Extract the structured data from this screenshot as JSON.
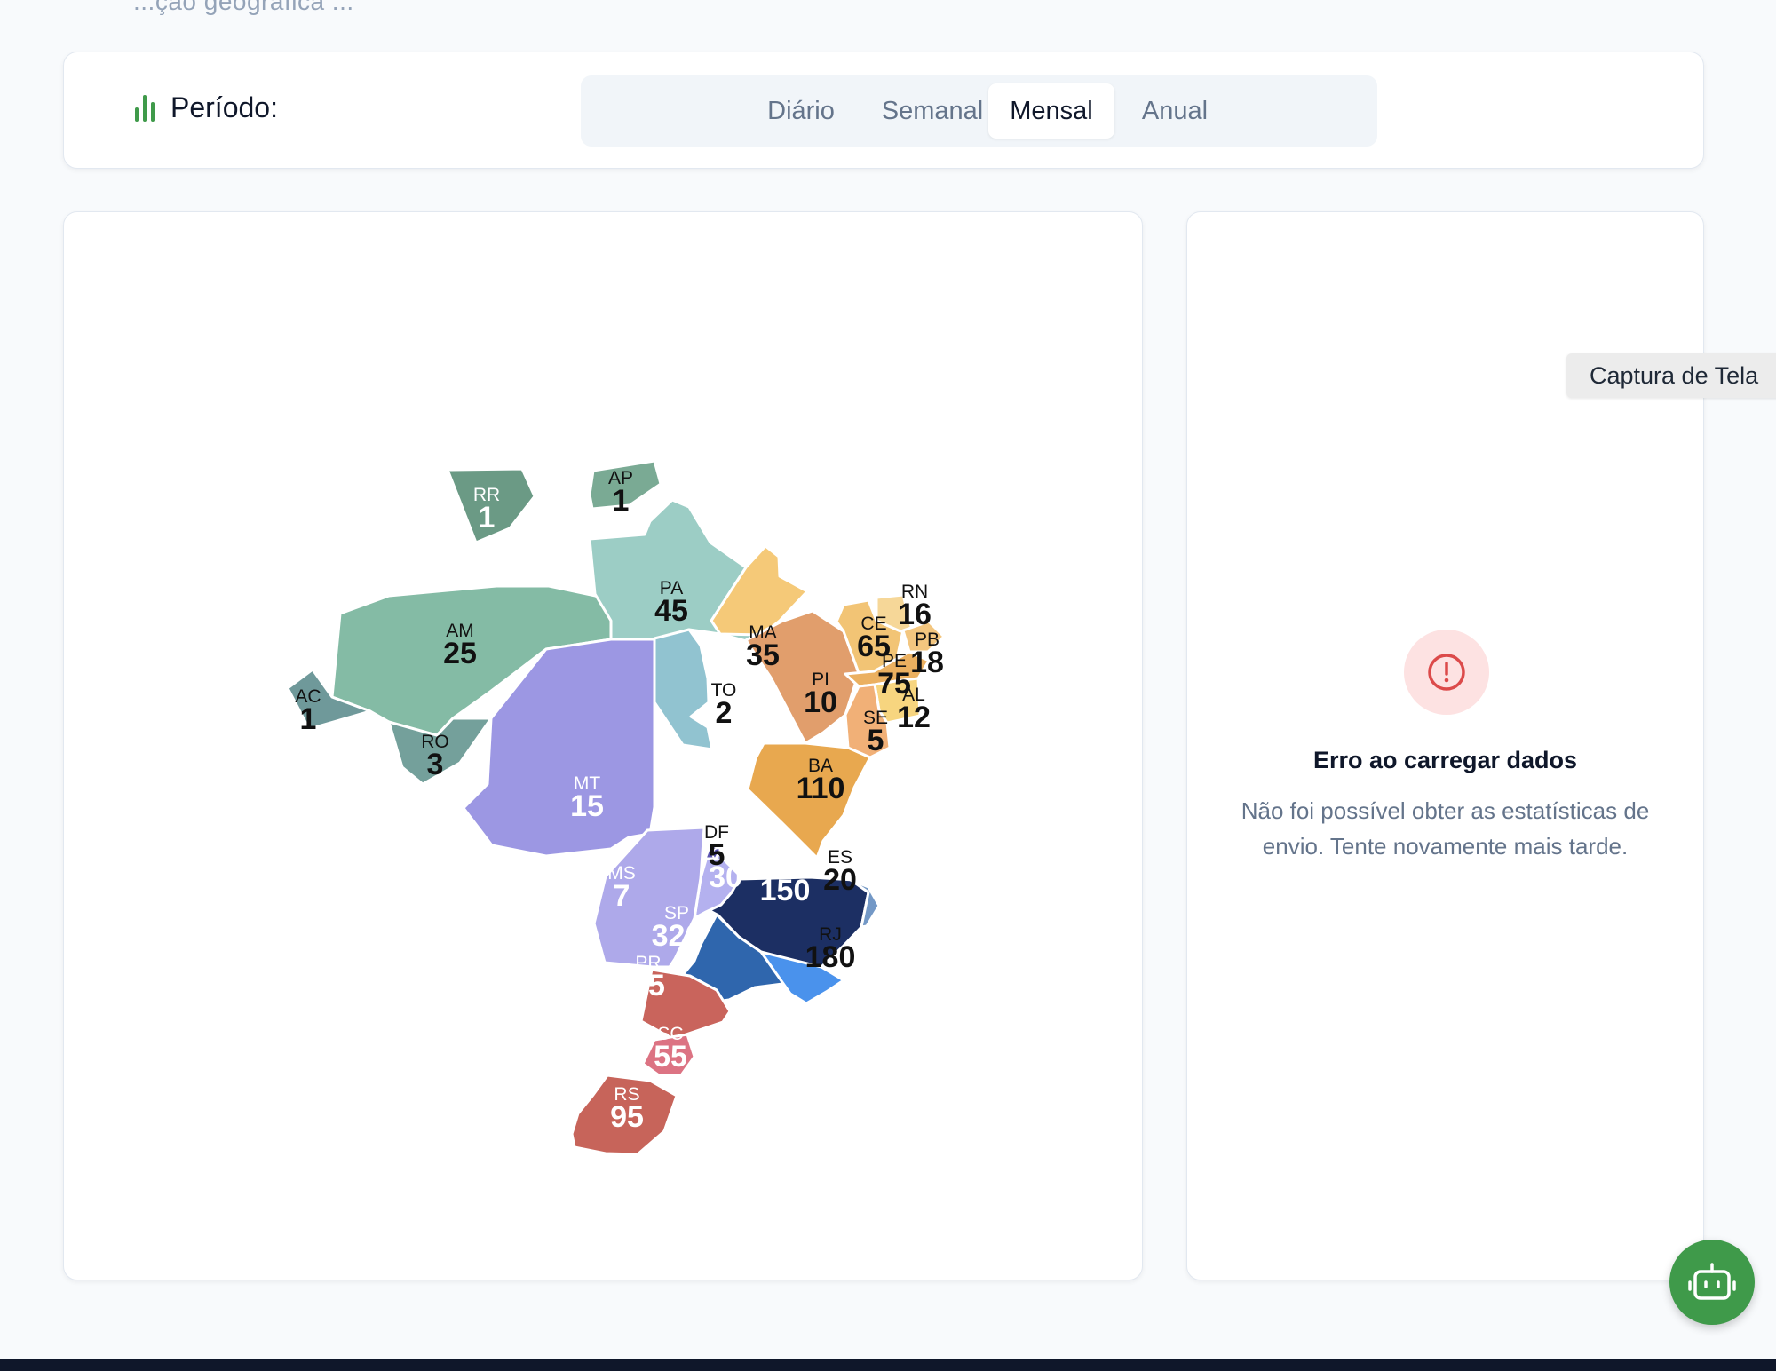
{
  "page_header_fragment": "...ção geográfica ...",
  "period": {
    "label": "Período:",
    "icon": "bar-chart-icon",
    "options": [
      "Diário",
      "Semanal",
      "Mensal",
      "Anual"
    ],
    "selected": "Mensal"
  },
  "map": {
    "states": [
      {
        "code": "RR",
        "value": "1",
        "color": "#6b9a85"
      },
      {
        "code": "AP",
        "value": "1",
        "color": "#7aaa94"
      },
      {
        "code": "PA",
        "value": "45",
        "color": "#9ccdc5"
      },
      {
        "code": "AM",
        "value": "25",
        "color": "#84bba5"
      },
      {
        "code": "AC",
        "value": "1",
        "color": "#6f999a"
      },
      {
        "code": "RO",
        "value": "3",
        "color": "#74a09b"
      },
      {
        "code": "MT",
        "value": "15",
        "color": "#9c97e3"
      },
      {
        "code": "TO",
        "value": "2",
        "color": "#91c3d0"
      },
      {
        "code": "MA",
        "value": "35",
        "color": "#f5c978"
      },
      {
        "code": "PI",
        "value": "10",
        "color": "#e19e6c"
      },
      {
        "code": "CE",
        "value": "65",
        "color": "#f2c475"
      },
      {
        "code": "RN",
        "value": "16",
        "color": "#f6d798"
      },
      {
        "code": "PB",
        "value": "18",
        "color": "#f3c67f"
      },
      {
        "code": "PE",
        "value": "75",
        "color": "#ebb060"
      },
      {
        "code": "AL",
        "value": "12",
        "color": "#f7d57f"
      },
      {
        "code": "SE",
        "value": "5",
        "color": "#f1b077"
      },
      {
        "code": "BA",
        "value": "110",
        "color": "#e8a84f"
      },
      {
        "code": "DF",
        "value": "5",
        "color": "#5a53b0"
      },
      {
        "code": "GO",
        "value": "30",
        "color": "#b4b1ef"
      },
      {
        "code": "MS",
        "value": "7",
        "color": "#aea9ea"
      },
      {
        "code": "MG",
        "value": "150",
        "color": "#1c2f63"
      },
      {
        "code": "ES",
        "value": "20",
        "color": "#7398c6"
      },
      {
        "code": "SP",
        "value": "320",
        "color": "#2f66ad"
      },
      {
        "code": "RJ",
        "value": "180",
        "color": "#4a92ec"
      },
      {
        "code": "PR",
        "value": "85",
        "color": "#c9645c"
      },
      {
        "code": "SC",
        "value": "55",
        "color": "#dc7383"
      },
      {
        "code": "RS",
        "value": "95",
        "color": "#c7645a"
      }
    ]
  },
  "error": {
    "icon": "alert-circle-icon",
    "title": "Erro ao carregar dados",
    "message": "Não foi possível obter as estatísticas de envio. Tente novamente mais tarde."
  },
  "tooltip": "Captura de Tela",
  "assistant_button": {
    "icon": "robot-icon"
  },
  "colors": {
    "accent": "#3f9a4a",
    "error": "#dc4a4a",
    "error_bg": "#fde2e2"
  }
}
